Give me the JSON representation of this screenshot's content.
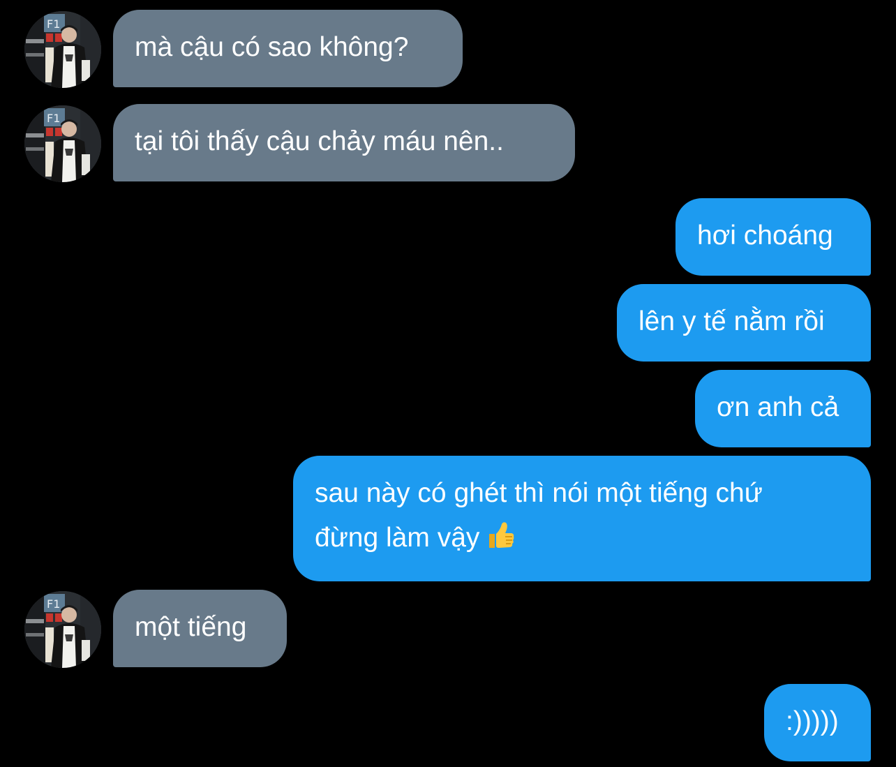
{
  "messages": [
    {
      "sender": "other",
      "lines": [
        "mà cậu có sao không?"
      ]
    },
    {
      "sender": "other",
      "lines": [
        "tại tôi thấy cậu chảy máu nên.."
      ]
    },
    {
      "sender": "me",
      "lines": [
        "hơi choáng"
      ]
    },
    {
      "sender": "me",
      "lines": [
        "lên y tế nằm rồi"
      ]
    },
    {
      "sender": "me",
      "lines": [
        "ơn anh cả"
      ]
    },
    {
      "sender": "me",
      "lines": [
        "sau này có ghét thì nói một tiếng chứ",
        "đừng làm vậy"
      ],
      "emoji": "thumbs-up-emoji"
    },
    {
      "sender": "other",
      "lines": [
        "một tiếng"
      ]
    },
    {
      "sender": "me",
      "lines": [
        ":)))))"
      ]
    }
  ],
  "avatar": {
    "sign_text": "F1",
    "icon": "profile-photo"
  },
  "colors": {
    "background": "#000000",
    "incoming_bubble": "#687a8a",
    "outgoing_bubble": "#1d9bf0",
    "text": "#ffffff"
  }
}
